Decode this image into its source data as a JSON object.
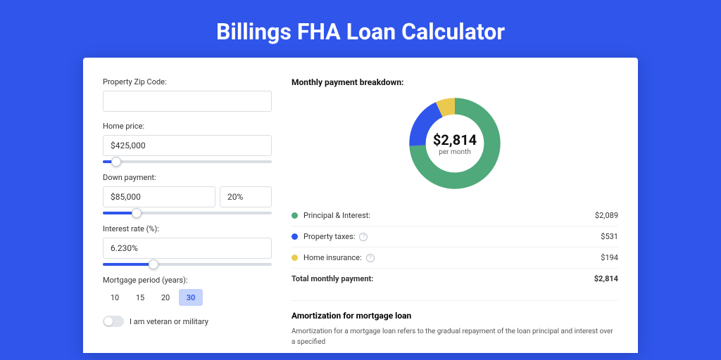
{
  "title": "Billings FHA Loan Calculator",
  "form": {
    "zip_label": "Property Zip Code:",
    "zip_value": "",
    "home_price_label": "Home price:",
    "home_price_value": "$425,000",
    "home_price_slider_pct": 8,
    "down_label": "Down payment:",
    "down_value": "$85,000",
    "down_pct_value": "20%",
    "down_slider_pct": 20,
    "rate_label": "Interest rate (%):",
    "rate_value": "6.230%",
    "rate_slider_pct": 30,
    "period_label": "Mortgage period (years):",
    "period_options": [
      "10",
      "15",
      "20",
      "30"
    ],
    "period_selected": "30",
    "veteran_label": "I am veteran or military",
    "veteran_on": false
  },
  "breakdown": {
    "title": "Monthly payment breakdown:",
    "center_value": "$2,814",
    "center_sub": "per month",
    "items": [
      {
        "label": "Principal & Interest:",
        "value": "$2,089",
        "color": "#4fa97a",
        "info": false,
        "pct": 74
      },
      {
        "label": "Property taxes:",
        "value": "$531",
        "color": "#2f55eb",
        "info": true,
        "pct": 19
      },
      {
        "label": "Home insurance:",
        "value": "$194",
        "color": "#eac94e",
        "info": true,
        "pct": 7
      }
    ],
    "total_label": "Total monthly payment:",
    "total_value": "$2,814"
  },
  "amort": {
    "title": "Amortization for mortgage loan",
    "text": "Amortization for a mortgage loan refers to the gradual repayment of the loan principal and interest over a specified"
  },
  "chart_data": {
    "type": "pie",
    "title": "Monthly payment breakdown",
    "series": [
      {
        "name": "Principal & Interest",
        "value": 2089,
        "color": "#4fa97a"
      },
      {
        "name": "Property taxes",
        "value": 531,
        "color": "#2f55eb"
      },
      {
        "name": "Home insurance",
        "value": 194,
        "color": "#eac94e"
      }
    ],
    "total": 2814,
    "center_label": "$2,814 per month"
  }
}
